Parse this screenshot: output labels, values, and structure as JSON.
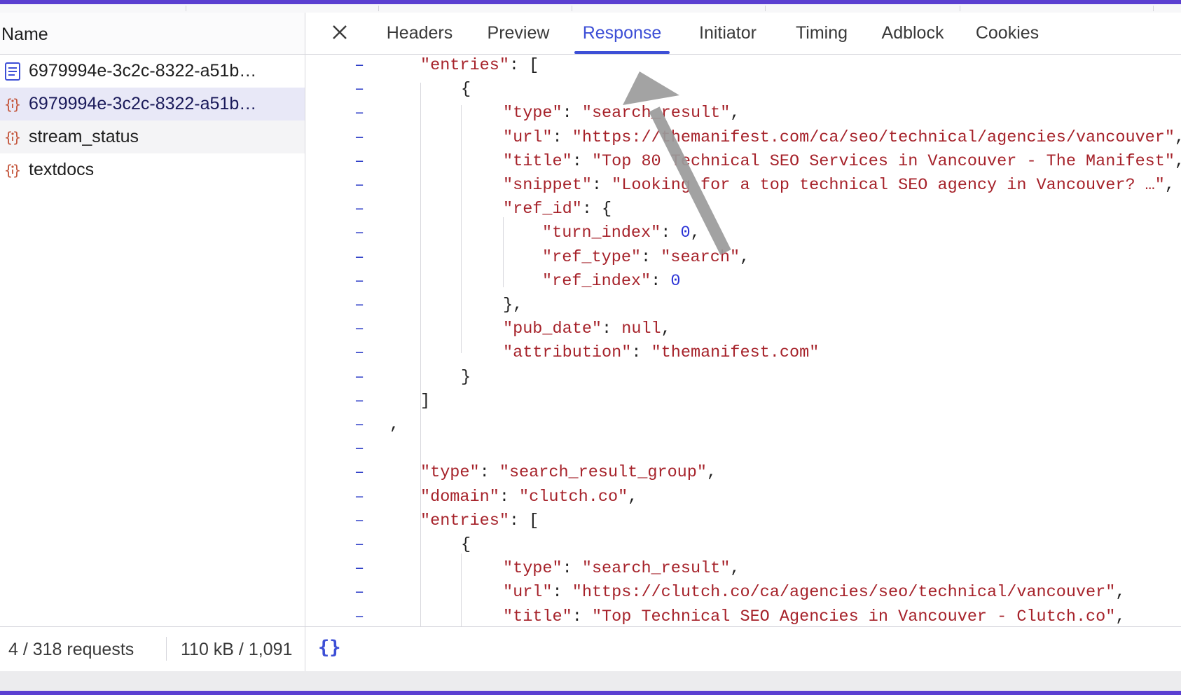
{
  "left_panel": {
    "column_header": "Name",
    "requests": [
      {
        "label": "6979994e-3c2c-8322-a51b…",
        "icon": "document-icon",
        "selected": false
      },
      {
        "label": "6979994e-3c2c-8322-a51b…",
        "icon": "json-braces-icon",
        "selected": true
      },
      {
        "label": "stream_status",
        "icon": "json-braces-icon",
        "selected": false
      },
      {
        "label": "textdocs",
        "icon": "json-braces-icon",
        "selected": false
      }
    ]
  },
  "detail_tabs": [
    "Headers",
    "Preview",
    "Response",
    "Initiator",
    "Timing",
    "Adblock",
    "Cookies"
  ],
  "active_tab": "Response",
  "response_lines": [
    {
      "indent": 2,
      "parts": [
        [
          "k",
          "\"entries\""
        ],
        [
          "p",
          ": ["
        ]
      ]
    },
    {
      "indent": 3,
      "parts": [
        [
          "p",
          "{"
        ]
      ]
    },
    {
      "indent": 4,
      "parts": [
        [
          "k",
          "\"type\""
        ],
        [
          "p",
          ": "
        ],
        [
          "s",
          "\"search_result\""
        ],
        [
          "p",
          ","
        ]
      ]
    },
    {
      "indent": 4,
      "parts": [
        [
          "k",
          "\"url\""
        ],
        [
          "p",
          ": "
        ],
        [
          "s",
          "\"https://themanifest.com/ca/seo/technical/agencies/vancouver\""
        ],
        [
          "p",
          ","
        ]
      ]
    },
    {
      "indent": 4,
      "parts": [
        [
          "k",
          "\"title\""
        ],
        [
          "p",
          ": "
        ],
        [
          "s",
          "\"Top 80 Technical SEO Services in Vancouver - The Manifest\""
        ],
        [
          "p",
          ","
        ]
      ]
    },
    {
      "indent": 4,
      "parts": [
        [
          "k",
          "\"snippet\""
        ],
        [
          "p",
          ": "
        ],
        [
          "s",
          "\"Looking for a top technical SEO agency in Vancouver? …\""
        ],
        [
          "p",
          ","
        ]
      ]
    },
    {
      "indent": 4,
      "parts": [
        [
          "k",
          "\"ref_id\""
        ],
        [
          "p",
          ": {"
        ]
      ]
    },
    {
      "indent": 5,
      "parts": [
        [
          "k",
          "\"turn_index\""
        ],
        [
          "p",
          ": "
        ],
        [
          "n",
          "0"
        ],
        [
          "p",
          ","
        ]
      ]
    },
    {
      "indent": 5,
      "parts": [
        [
          "k",
          "\"ref_type\""
        ],
        [
          "p",
          ": "
        ],
        [
          "s",
          "\"search\""
        ],
        [
          "p",
          ","
        ]
      ]
    },
    {
      "indent": 5,
      "parts": [
        [
          "k",
          "\"ref_index\""
        ],
        [
          "p",
          ": "
        ],
        [
          "n",
          "0"
        ]
      ]
    },
    {
      "indent": 4,
      "parts": [
        [
          "p",
          "},"
        ]
      ]
    },
    {
      "indent": 4,
      "parts": [
        [
          "k",
          "\"pub_date\""
        ],
        [
          "p",
          ": "
        ],
        [
          "s",
          "null"
        ],
        [
          "p",
          ","
        ]
      ]
    },
    {
      "indent": 4,
      "parts": [
        [
          "k",
          "\"attribution\""
        ],
        [
          "p",
          ": "
        ],
        [
          "s",
          "\"themanifest.com\""
        ]
      ]
    },
    {
      "indent": 3,
      "parts": [
        [
          "p",
          "}"
        ]
      ]
    },
    {
      "indent": 2,
      "parts": [
        [
          "p",
          "]"
        ]
      ]
    },
    {
      "indent": 1,
      "parts": [
        [
          "p",
          ","
        ]
      ]
    },
    {
      "indent": 1,
      "parts": []
    },
    {
      "indent": 2,
      "parts": [
        [
          "k",
          "\"type\""
        ],
        [
          "p",
          ": "
        ],
        [
          "s",
          "\"search_result_group\""
        ],
        [
          "p",
          ","
        ]
      ]
    },
    {
      "indent": 2,
      "parts": [
        [
          "k",
          "\"domain\""
        ],
        [
          "p",
          ": "
        ],
        [
          "s",
          "\"clutch.co\""
        ],
        [
          "p",
          ","
        ]
      ]
    },
    {
      "indent": 2,
      "parts": [
        [
          "k",
          "\"entries\""
        ],
        [
          "p",
          ": ["
        ]
      ]
    },
    {
      "indent": 3,
      "parts": [
        [
          "p",
          "{"
        ]
      ]
    },
    {
      "indent": 4,
      "parts": [
        [
          "k",
          "\"type\""
        ],
        [
          "p",
          ": "
        ],
        [
          "s",
          "\"search_result\""
        ],
        [
          "p",
          ","
        ]
      ]
    },
    {
      "indent": 4,
      "parts": [
        [
          "k",
          "\"url\""
        ],
        [
          "p",
          ": "
        ],
        [
          "s",
          "\"https://clutch.co/ca/agencies/seo/technical/vancouver\""
        ],
        [
          "p",
          ","
        ]
      ]
    },
    {
      "indent": 4,
      "parts": [
        [
          "k",
          "\"title\""
        ],
        [
          "p",
          ": "
        ],
        [
          "s",
          "\"Top Technical SEO Agencies in Vancouver - Clutch.co\""
        ],
        [
          "p",
          ","
        ]
      ]
    }
  ],
  "status_bar": {
    "requests": "4 / 318 requests",
    "transferred": "110 kB / 1,091",
    "pretty_print_label": "{}"
  },
  "colors": {
    "accent": "#3d4fd6",
    "json_key": "#a6222a",
    "json_number": "#2b33d6",
    "frame": "#5b3fd1"
  }
}
